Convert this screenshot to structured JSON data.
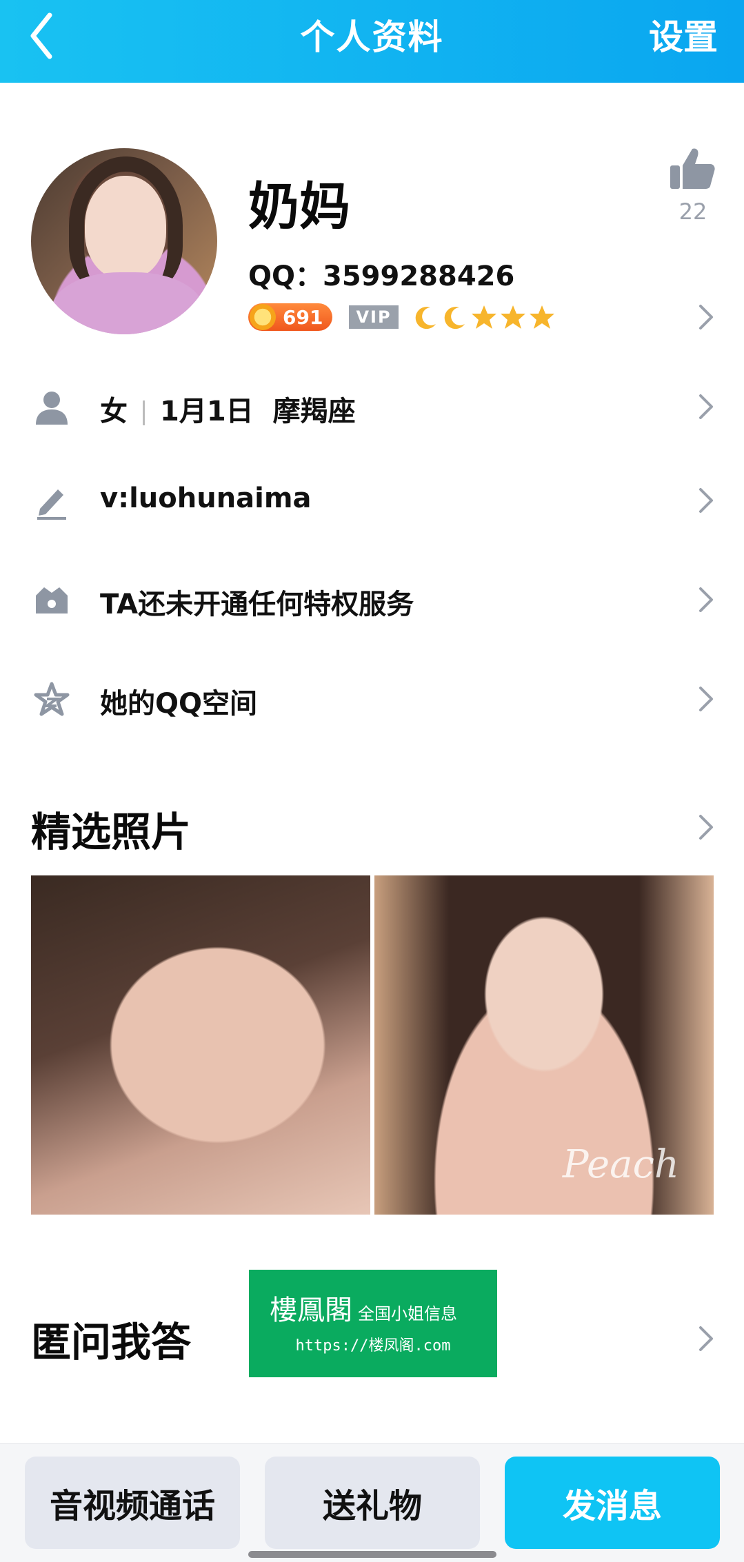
{
  "header": {
    "title": "个人资料",
    "settings_label": "设置"
  },
  "profile": {
    "nickname": "奶妈",
    "qq_label": "QQ：",
    "qq_number": "3599288426",
    "like_count": "22",
    "level_number": "691",
    "vip_label": "VIP",
    "level_icons": [
      "moon-icon",
      "moon-icon",
      "star-icon",
      "star-icon",
      "star-icon"
    ]
  },
  "info_rows": {
    "gender": "女",
    "birthday": "1月1日",
    "zodiac": "摩羯座",
    "signature": "v:luohunaima",
    "privilege": "TA还未开通任何特权服务",
    "qzone": "她的QQ空间"
  },
  "photos": {
    "title": "精选照片",
    "watermark": "Peach"
  },
  "qa": {
    "title": "匿问我答"
  },
  "ad": {
    "name": "樓鳳閣",
    "tagline": "全国小姐信息",
    "url": "https://楼凤阁.com"
  },
  "actions": {
    "call": "音视频通话",
    "gift": "送礼物",
    "message": "发消息"
  },
  "colors": {
    "header": "#0aa6f0",
    "accent": "#0fc4f4",
    "ad_green": "#0aab5f"
  }
}
